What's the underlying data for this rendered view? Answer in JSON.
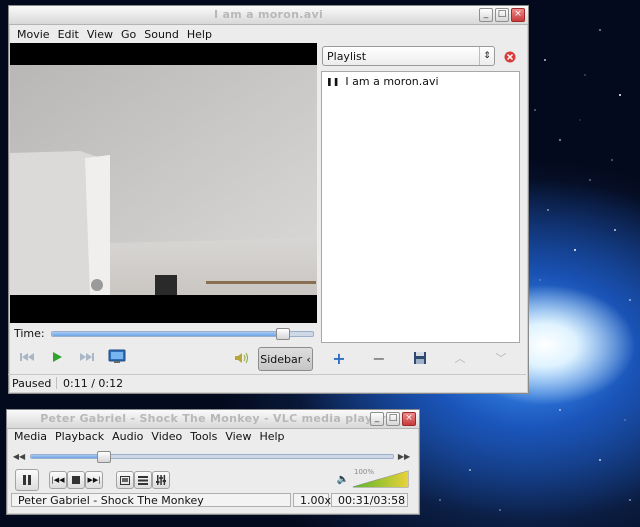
{
  "main_window": {
    "title": "I am a moron.avi",
    "menu": [
      "Movie",
      "Edit",
      "View",
      "Go",
      "Sound",
      "Help"
    ],
    "time_label": "Time:",
    "seek_progress": 0.88,
    "sidebar_button": "Sidebar",
    "status_state": "Paused",
    "status_time": "0:11 / 0:12",
    "playlist_select": "Playlist",
    "playlist_items": [
      "I am a moron.avi"
    ]
  },
  "vlc_window": {
    "title": "Peter Gabriel - Shock The Monkey - VLC media player",
    "menu": [
      "Media",
      "Playback",
      "Audio",
      "Video",
      "Tools",
      "View",
      "Help"
    ],
    "seek_progress": 0.2,
    "volume_label": "100%",
    "volume_level": 1.0,
    "status_track": "Peter Gabriel - Shock The Monkey",
    "status_speed": "1.00x",
    "status_time": "00:31/03:58"
  },
  "colors": {
    "accent_blue": "#3a7bd5",
    "play_green": "#2fa52f",
    "close_red": "#d93a3a",
    "volume_green": "#5ab52a",
    "volume_yellow": "#e8d23a"
  }
}
